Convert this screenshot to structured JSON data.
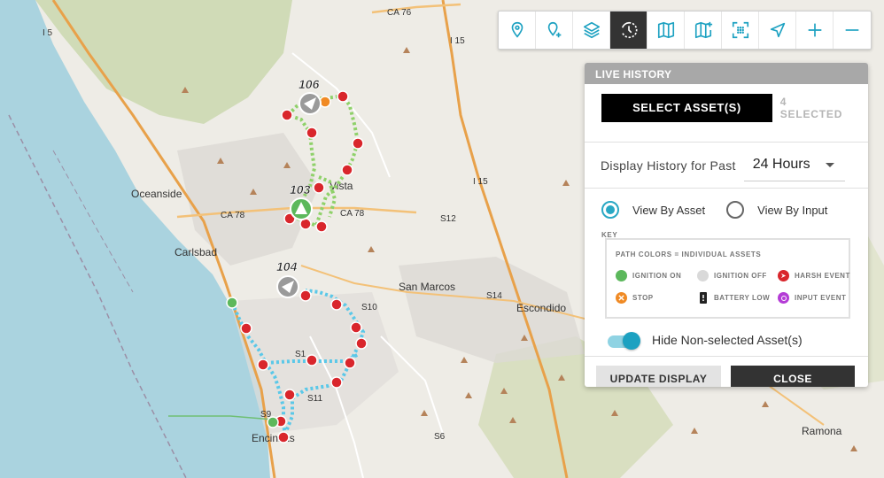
{
  "map": {
    "labels": {
      "ca76": "CA 76",
      "i5": "I 5",
      "i15_top": "I 15",
      "i15_mid": "I 15",
      "oceanside": "Oceanside",
      "ca78_a": "CA 78",
      "ca78_b": "CA 78",
      "s12": "S12",
      "carlsbad": "Carlsbad",
      "san_marcos": "San Marcos",
      "s14": "S14",
      "s10": "S10",
      "escondido": "Escondido",
      "s11_a": "S1",
      "s11_b": "S11",
      "s9": "S9",
      "s6": "S6",
      "encinitas": "Encinitas",
      "ramona": "Ramona",
      "vista": "Vista"
    },
    "assets": [
      {
        "id": "106",
        "label": "106"
      },
      {
        "id": "103",
        "label": "103"
      },
      {
        "id": "104",
        "label": "104"
      }
    ]
  },
  "toolbar": {
    "buttons": [
      {
        "name": "location-pin-icon",
        "active": false
      },
      {
        "name": "add-location-icon",
        "active": false
      },
      {
        "name": "layers-icon",
        "active": false
      },
      {
        "name": "history-icon",
        "active": true
      },
      {
        "name": "map-icon",
        "active": false
      },
      {
        "name": "add-map-icon",
        "active": false
      },
      {
        "name": "geofence-select-icon",
        "active": false
      },
      {
        "name": "navigation-arrow-icon",
        "active": false
      },
      {
        "name": "zoom-in-icon",
        "active": false
      },
      {
        "name": "zoom-out-icon",
        "active": false
      }
    ]
  },
  "panel": {
    "title": "LIVE HISTORY",
    "select_button": "SELECT ASSET(S)",
    "selected_count": "4 SELECTED",
    "history_label": "Display History for Past",
    "history_value": "24 Hours",
    "view_by_asset": "View By Asset",
    "view_by_input": "View By Input",
    "key_title": "KEY",
    "key_heading": "PATH COLORS = INDIVIDUAL ASSETS",
    "key_items": [
      {
        "label": "IGNITION ON",
        "color": "#5cb85c",
        "icon": "ignition-on-icon"
      },
      {
        "label": "IGNITION OFF",
        "color": "#d9d9d9",
        "icon": "ignition-off-icon"
      },
      {
        "label": "HARSH EVENT",
        "color": "#d9262c",
        "icon": "harsh-event-icon"
      },
      {
        "label": "STOP",
        "color": "#f08a24",
        "icon": "stop-icon"
      },
      {
        "label": "BATTERY LOW",
        "color": "#222222",
        "icon": "battery-low-icon"
      },
      {
        "label": "INPUT EVENT",
        "color": "#b43cd6",
        "icon": "input-event-icon"
      }
    ],
    "toggle_label": "Hide Non-selected Asset(s)",
    "update_button": "UPDATE DISPLAY",
    "close_button": "CLOSE"
  },
  "colors": {
    "accent": "#1ca1c1",
    "route_green": "#8fd16a",
    "route_blue": "#5bc8e8",
    "harsh_red": "#d9262c"
  }
}
